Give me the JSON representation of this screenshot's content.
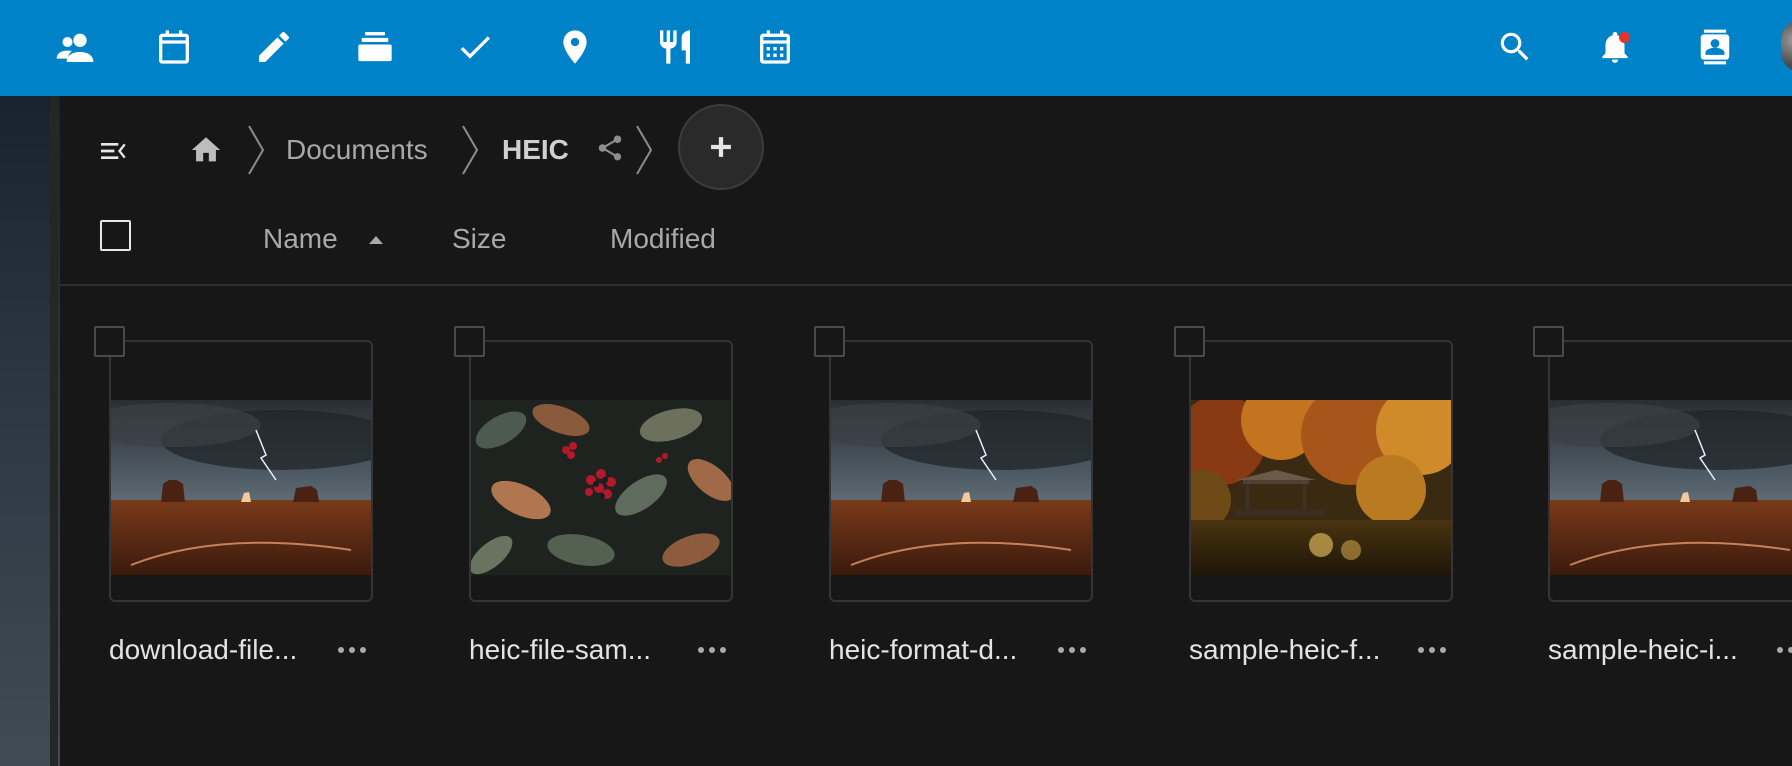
{
  "topbar": {
    "apps": [
      {
        "name": "contacts-app-icon",
        "icon": "people-icon"
      },
      {
        "name": "calendar-app-icon",
        "icon": "calendar-icon"
      },
      {
        "name": "notes-app-icon",
        "icon": "pencil-icon"
      },
      {
        "name": "deck-app-icon",
        "icon": "stack-icon"
      },
      {
        "name": "tasks-app-icon",
        "icon": "checkmark-icon"
      },
      {
        "name": "maps-app-icon",
        "icon": "map-pin-icon"
      },
      {
        "name": "cookbook-app-icon",
        "icon": "fork-knife-icon"
      },
      {
        "name": "schedule-app-icon",
        "icon": "calendar-grid-icon"
      }
    ],
    "right_icons": [
      "search-icon",
      "bell-icon",
      "contacts-menu-icon"
    ],
    "colors": {
      "bar": "#0082c9",
      "notification_dot": "#e9322d"
    }
  },
  "breadcrumb": {
    "home_icon": "home-icon",
    "items": [
      "Documents",
      "HEIC"
    ],
    "share_icon": "share-icon",
    "new_button_icon": "plus-icon"
  },
  "columns": {
    "name": "Name",
    "size": "Size",
    "modified": "Modified",
    "sort_icon": "triangle-up-icon"
  },
  "files": [
    {
      "name": "download-file...",
      "thumbnail": "desert-storm"
    },
    {
      "name": "heic-file-sam...",
      "thumbnail": "leaves-berries"
    },
    {
      "name": "heic-format-d...",
      "thumbnail": "desert-storm"
    },
    {
      "name": "sample-heic-f...",
      "thumbnail": "autumn-pond"
    },
    {
      "name": "sample-heic-i...",
      "thumbnail": "desert-storm"
    }
  ]
}
